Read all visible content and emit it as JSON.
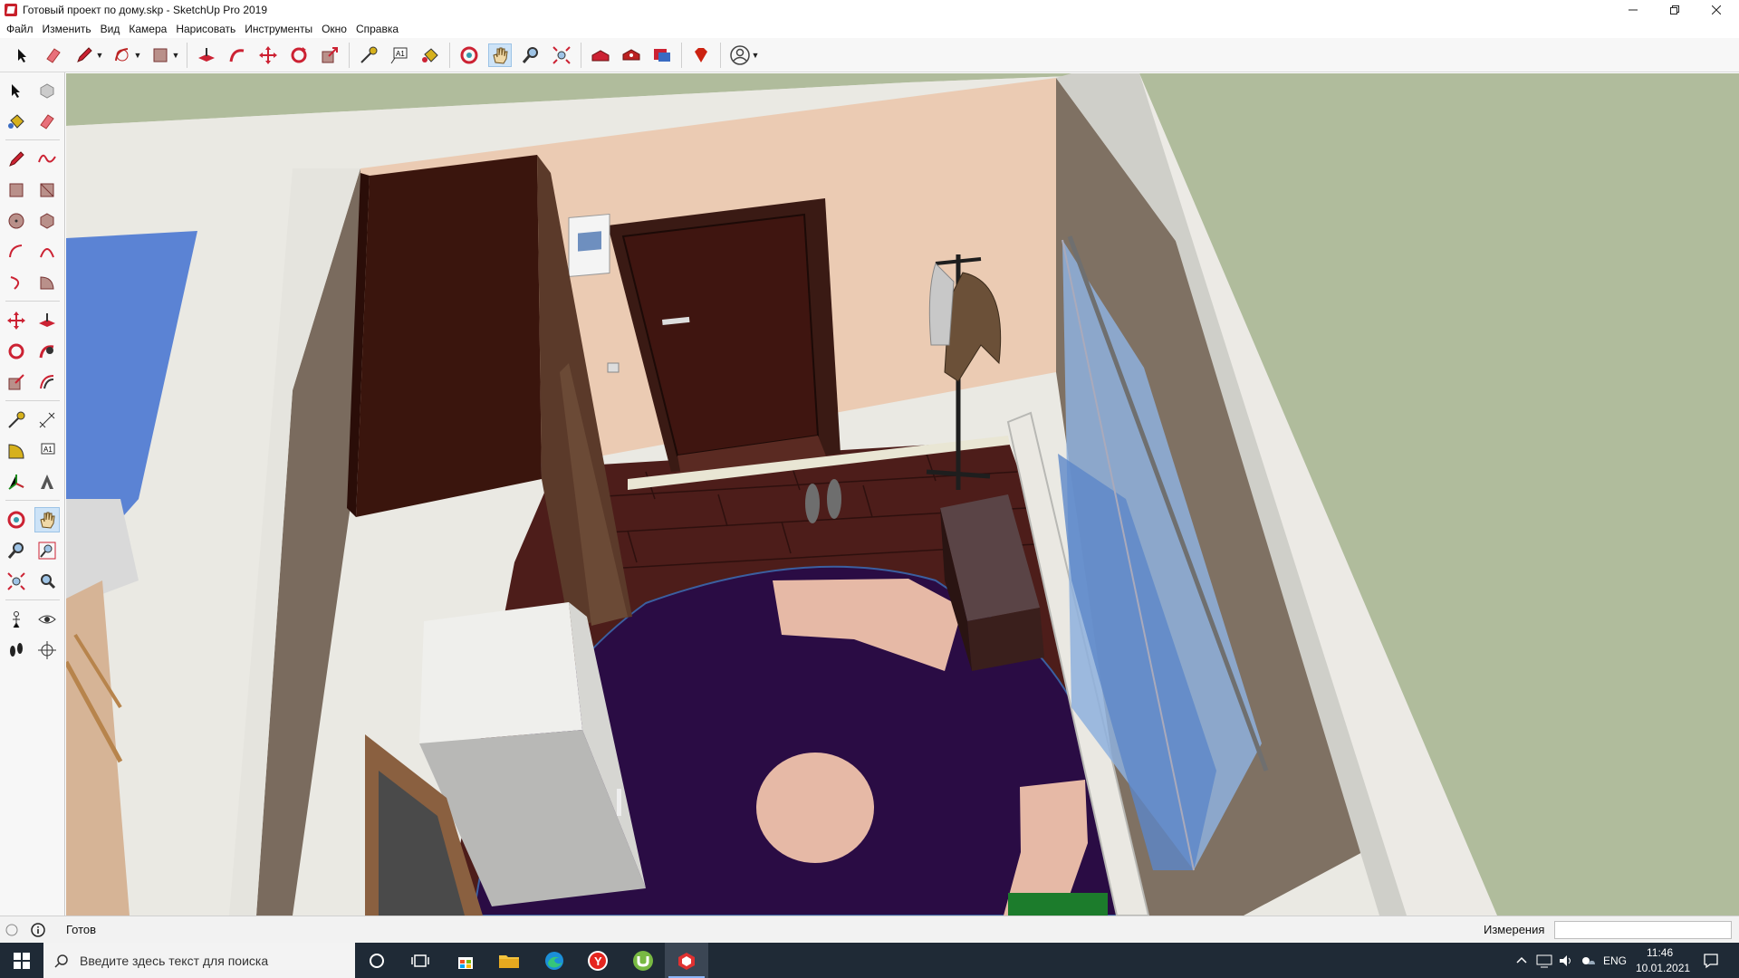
{
  "window": {
    "title": "Готовый проект по дому.skp - SketchUp Pro 2019",
    "minimize_icon": "minimize-icon",
    "maximize_icon": "restore-icon",
    "close_icon": "close-icon"
  },
  "menu": [
    "Файл",
    "Изменить",
    "Вид",
    "Камера",
    "Нарисовать",
    "Инструменты",
    "Окно",
    "Справка"
  ],
  "toolbar_icons": [
    "select-icon",
    "eraser-icon",
    "pencil-icon",
    "arc-icon",
    "rectangle-icon",
    "push-pull-icon",
    "follow-me-icon",
    "move-icon",
    "rotate-icon",
    "scale-icon",
    "tape-measure-icon",
    "text-icon",
    "paint-bucket-icon",
    "orbit-icon",
    "pan-icon",
    "zoom-icon",
    "zoom-extents-icon",
    "warehouse-icon",
    "extension-warehouse-icon",
    "layout-icon",
    "ruby-icon",
    "account-icon"
  ],
  "status": {
    "text": "Готов",
    "measurements_label": "Измерения",
    "measurements_value": ""
  },
  "taskbar": {
    "search_placeholder": "Введите здесь текст для поиска",
    "language": "ENG",
    "time": "11:46",
    "date": "10.01.2021"
  },
  "colors": {
    "wall": "#ebcbb3",
    "wardrobe": "#3a150d",
    "floor_tiles": "#4d1d1a",
    "carpet": "#2a0c44",
    "carpet_pattern": "#e6b9a6",
    "grass": "#b0bc9c",
    "window_glass": "#8eb0dd",
    "accent_active": "#cde3f7"
  }
}
